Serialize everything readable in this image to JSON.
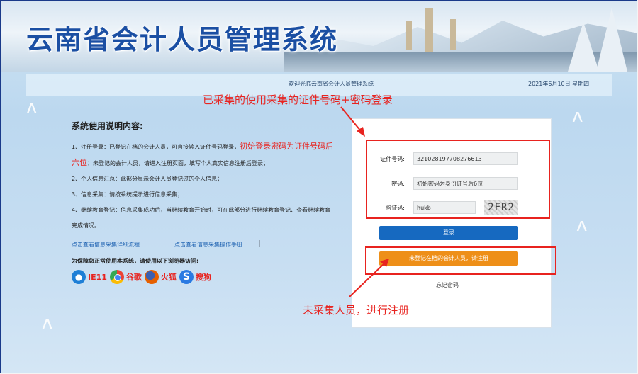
{
  "header": {
    "title": "云南省会计人员管理系统",
    "welcome": "欢迎光临云南省会计人员管理系统",
    "date": "2021年6月10日 星期四"
  },
  "annotations": {
    "login_note": "已采集的使用采集的证件号码+密码登录",
    "register_note": "未采集人员，进行注册"
  },
  "instructions": {
    "heading": "系统使用说明内容:",
    "item1_a": "1、注册登录：已登记在档的会计人员，可直接输入证件号码登录，",
    "item1_red": "初始登录密码为证件号码后六位",
    "item1_b": "；未登记的会计人员，请进入注册页面，填写个人真实信息注册后登录；",
    "item2": "2、个人信息汇总：此部分显示会计人员登记过的个人信息；",
    "item3": "3、信息采集：请按系统提示进行信息采集；",
    "item4": "4、继续教育登记：信息采集成功后，当继续教育开始时，可在此部分进行继续教育登记、查看继续教育完成情况。",
    "link_flow": "点击查看信息采集详细流程",
    "link_manual": "点击查看信息采集操作手册",
    "browser_note": "为保障您正常使用本系统，请使用以下浏览器访问:",
    "browsers": [
      {
        "label": "IE11",
        "icon": "ie-icon",
        "color": "#1e7fd6"
      },
      {
        "label": "谷歌",
        "icon": "chrome-icon",
        "color": "#4285f4"
      },
      {
        "label": "火狐",
        "icon": "firefox-icon",
        "color": "#e66000"
      },
      {
        "label": "搜狗",
        "icon": "sogou-icon",
        "color": "#2a7ae2"
      }
    ]
  },
  "login": {
    "id_label": "证件号码:",
    "id_value": "321028197708276613",
    "password_label": "密码:",
    "password_value": "初始密码为身份证号后6位",
    "captcha_label": "验证码:",
    "captcha_value": "hukb",
    "captcha_image_text": "2FR2",
    "login_button": "登录",
    "register_button": "未登记在档的会计人员，请注册",
    "forgot_link": "忘记密码"
  },
  "colors": {
    "accent": "#1669c0",
    "register": "#ee8f18",
    "annotation": "#e8231f",
    "title": "#1b4fa3"
  }
}
